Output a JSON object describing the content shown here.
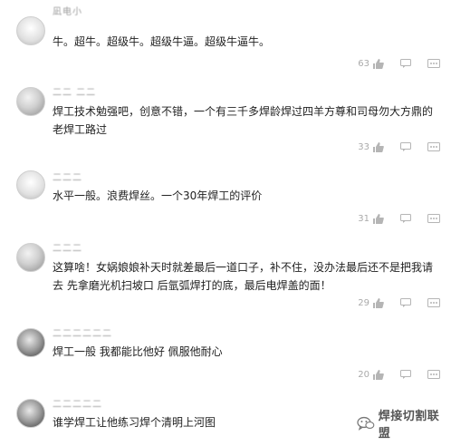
{
  "comments": [
    {
      "username": "凪电小",
      "text": "牛。超牛。超级牛。超级牛逼。超级牛逼牛。",
      "likes": "63"
    },
    {
      "username": "二二 二二",
      "text": "焊工技术勉强吧，创意不错，一个有三千多焊龄焊过四羊方尊和司母勿大方鼎的老焊工路过",
      "likes": "33"
    },
    {
      "username": "二二二",
      "text": "水平一般。浪费焊丝。一个30年焊工的评价",
      "likes": "31"
    },
    {
      "username": "二二二",
      "text": "这算啥！女娲娘娘补天时就差最后一道口子，补不住，没办法最后还不是把我请去 先拿磨光机扫坡口 后氩弧焊打的底，最后电焊盖的面！",
      "likes": "29"
    },
    {
      "username": "二二二二二二",
      "text": "焊工一般 我都能比他好 佩服他耐心",
      "likes": "20"
    },
    {
      "username": "二二二二二",
      "text": "谁学焊工让他练习焊个清明上河图",
      "likes": ""
    }
  ],
  "watermark": {
    "text": "焊接切割联盟",
    "icon": "wechat-icon"
  },
  "icons": {
    "like": "thumbs-up-icon",
    "comment": "comment-icon",
    "more": "more-icon"
  }
}
